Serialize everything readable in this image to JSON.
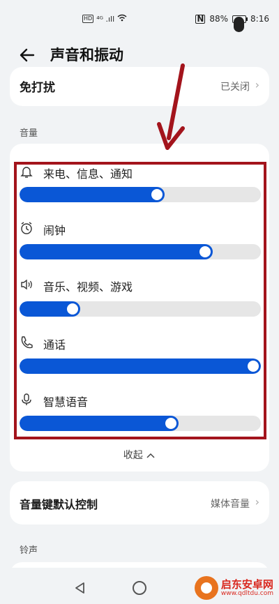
{
  "status_bar": {
    "hd": "HD",
    "signal": "⁴ᴳ .ıll",
    "nfc": "N",
    "battery": "88%",
    "time": "8:16"
  },
  "header": {
    "title": "声音和振动",
    "back_icon": "back-arrow-icon"
  },
  "dnd": {
    "label": "免打扰",
    "value": "已关闭"
  },
  "volume_section": {
    "label": "音量",
    "sliders": [
      {
        "label": "来电、信息、通知",
        "icon": "bell-icon",
        "level": 0.6
      },
      {
        "label": "闹钟",
        "icon": "alarm-clock-icon",
        "level": 0.8
      },
      {
        "label": "音乐、视频、游戏",
        "icon": "speaker-icon",
        "level": 0.25
      },
      {
        "label": "通话",
        "icon": "phone-icon",
        "level": 1.0
      },
      {
        "label": "智慧语音",
        "icon": "microphone-icon",
        "level": 0.66
      }
    ],
    "collapse_label": "收起"
  },
  "key_control": {
    "label": "音量键默认控制",
    "value": "媒体音量"
  },
  "ringtone_section": {
    "label": "铃声"
  },
  "watermark": {
    "name": "启东安卓网",
    "url": "www.qdltdu.com"
  },
  "colors": {
    "accent": "#0a57d6",
    "annotation": "#a3141c",
    "background": "#f1f3f5"
  }
}
